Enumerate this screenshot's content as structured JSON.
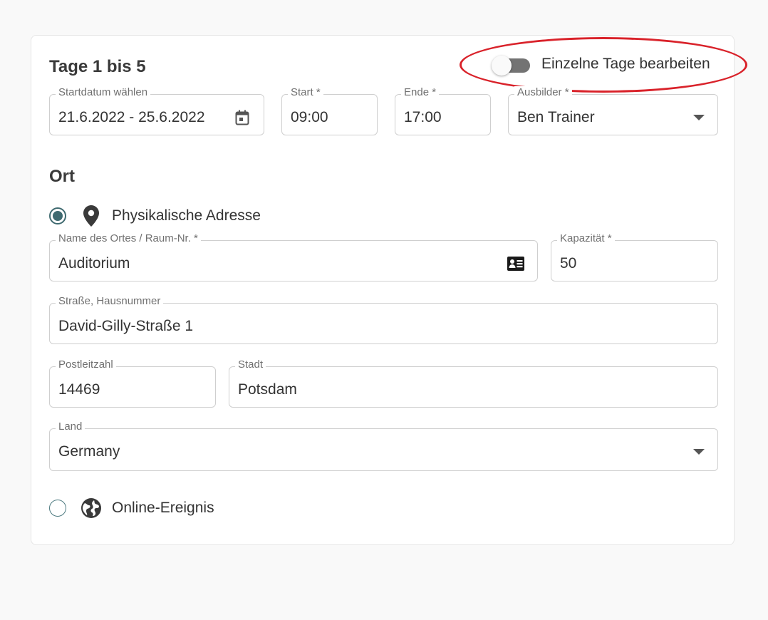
{
  "card": {
    "title": "Tage 1 bis 5",
    "toggle": {
      "label": "Einzelne Tage bearbeiten",
      "checked": false
    }
  },
  "schedule": {
    "date": {
      "label": "Startdatum wählen",
      "value": "21.6.2022 - 25.6.2022",
      "icon": "calendar-icon"
    },
    "start": {
      "label": "Start *",
      "value": "09:00"
    },
    "end": {
      "label": "Ende *",
      "value": "17:00"
    },
    "trainer": {
      "label": "Ausbilder *",
      "value": "Ben Trainer"
    }
  },
  "location": {
    "title": "Ort",
    "physical": {
      "label": "Physikalische Adresse",
      "icon": "map-pin-icon",
      "selected": true,
      "place": {
        "label": "Name des Ortes / Raum-Nr. *",
        "value": "Auditorium",
        "icon": "contact-card-icon"
      },
      "capacity": {
        "label": "Kapazität *",
        "value": "50"
      },
      "street": {
        "label": "Straße, Hausnummer",
        "value": "David-Gilly-Straße 1"
      },
      "zip": {
        "label": "Postleitzahl",
        "value": "14469"
      },
      "city": {
        "label": "Stadt",
        "value": "Potsdam"
      },
      "country": {
        "label": "Land",
        "value": "Germany"
      }
    },
    "online": {
      "label": "Online-Ereignis",
      "icon": "globe-icon",
      "selected": false
    }
  },
  "colors": {
    "accent": "#3f6a70",
    "highlight_ellipse": "#d9222a",
    "toggle_track": "#737373"
  }
}
